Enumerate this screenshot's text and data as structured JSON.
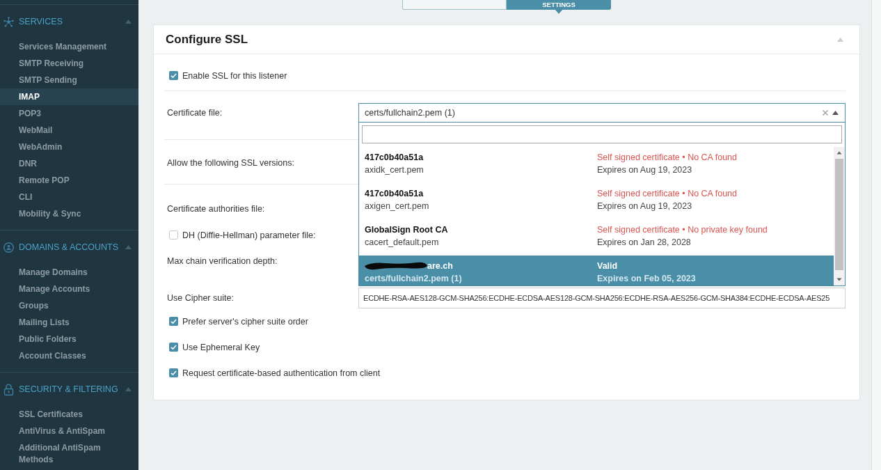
{
  "sidebar": {
    "sections": [
      {
        "title": "SERVICES",
        "expanded": true,
        "items": [
          {
            "label": "Services Management",
            "selected": false
          },
          {
            "label": "SMTP Receiving",
            "selected": false
          },
          {
            "label": "SMTP Sending",
            "selected": false
          },
          {
            "label": "IMAP",
            "selected": true
          },
          {
            "label": "POP3",
            "selected": false
          },
          {
            "label": "WebMail",
            "selected": false
          },
          {
            "label": "WebAdmin",
            "selected": false
          },
          {
            "label": "DNR",
            "selected": false
          },
          {
            "label": "Remote POP",
            "selected": false
          },
          {
            "label": "CLI",
            "selected": false
          },
          {
            "label": "Mobility & Sync",
            "selected": false
          }
        ]
      },
      {
        "title": "DOMAINS & ACCOUNTS",
        "expanded": true,
        "items": [
          {
            "label": "Manage Domains",
            "selected": false
          },
          {
            "label": "Manage Accounts",
            "selected": false
          },
          {
            "label": "Groups",
            "selected": false
          },
          {
            "label": "Mailing Lists",
            "selected": false
          },
          {
            "label": "Public Folders",
            "selected": false
          },
          {
            "label": "Account Classes",
            "selected": false
          }
        ]
      },
      {
        "title": "SECURITY & FILTERING",
        "expanded": true,
        "items": [
          {
            "label": "SSL Certificates",
            "selected": false
          },
          {
            "label": "AntiVirus & AntiSpam",
            "selected": false
          },
          {
            "label": "Additional AntiSpam Methods",
            "selected": false
          }
        ]
      }
    ]
  },
  "tabs": [
    {
      "selected": false
    },
    {
      "label": "SETTINGS",
      "selected": true
    }
  ],
  "card": {
    "title": "Configure SSL",
    "expanded": true,
    "groups": [
      [
        {
          "kind": "checkbox",
          "label": "Enable SSL for this listener",
          "checked": true
        }
      ],
      [
        {
          "kind": "select",
          "label": "Certificate file:",
          "value": "certs/fullchain2.pem (1)",
          "expanded": true,
          "options": [
            {
              "name": "417c0b40a51a",
              "redacted": false,
              "file": "axidk_cert.pem",
              "status": "Self signed certificate • No CA found",
              "valid": false,
              "expires": "Expires on Aug 19, 2023",
              "selected": false
            },
            {
              "name": "417c0b40a51a",
              "redacted": false,
              "file": "axigen_cert.pem",
              "status": "Self signed certificate • No CA found",
              "valid": false,
              "expires": "Expires on Aug 19, 2023",
              "selected": false
            },
            {
              "name": "GlobalSign Root CA",
              "redacted": false,
              "file": "cacert_default.pem",
              "status": "Self signed certificate • No private key found",
              "valid": false,
              "expires": "Expires on Jan 28, 2028",
              "selected": false
            },
            {
              "name": "are.ch",
              "redacted": true,
              "file": "certs/fullchain2.pem (1)",
              "status": "Valid",
              "valid": true,
              "expires": "Expires on Feb 05, 2023",
              "selected": true
            }
          ]
        }
      ],
      [
        {
          "kind": "field",
          "label": "Allow the following SSL versions:"
        }
      ],
      [
        {
          "kind": "field",
          "label": "Certificate authorities file:"
        },
        {
          "kind": "checkbox",
          "label": "DH (Diffie-Hellman) parameter file:",
          "checked": false
        },
        {
          "kind": "field",
          "label": "Max chain verification depth:"
        },
        {
          "kind": "input",
          "label": "Use Cipher suite:",
          "value": "ECDHE-RSA-AES128-GCM-SHA256:ECDHE-ECDSA-AES128-GCM-SHA256:ECDHE-RSA-AES256-GCM-SHA384:ECDHE-ECDSA-AES25"
        },
        {
          "kind": "checkbox",
          "label": "Prefer server's cipher suite order",
          "checked": true
        },
        {
          "kind": "checkbox",
          "label": "Use Ephemeral Key",
          "checked": true
        },
        {
          "kind": "checkbox",
          "label": "Request certificate-based authentication from client",
          "checked": true
        }
      ]
    ]
  }
}
